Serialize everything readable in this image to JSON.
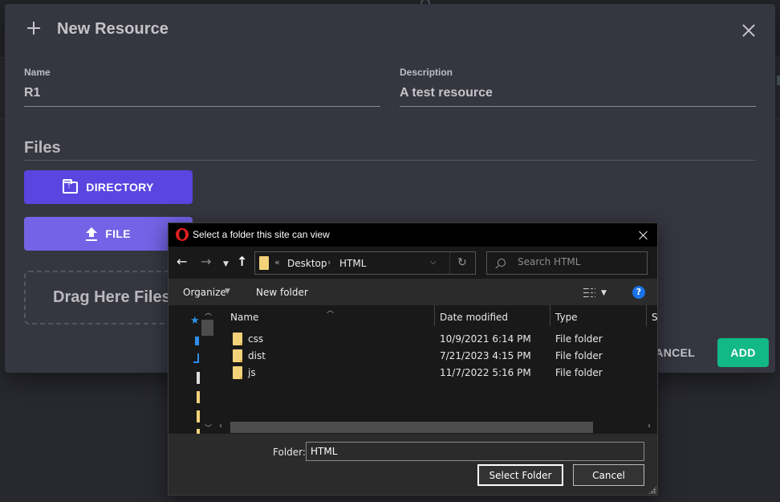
{
  "modal": {
    "title": "New Resource",
    "name_label": "Name",
    "name_value": "R1",
    "description_label": "Description",
    "description_value": "A test resource",
    "files_heading": "Files",
    "directory_button": "DIRECTORY",
    "file_button": "FILE",
    "dropzone_text": "Drag Here Files",
    "cancel_button": "CANCEL",
    "add_button": "ADD",
    "colors": {
      "directory_button": "#5a45e0",
      "file_button": "#7463e6",
      "add_button": "#12b886",
      "background": "#363641"
    }
  },
  "dialog": {
    "title": "Select a folder this site can view",
    "icons": {
      "app": "opera-logo-icon",
      "back": "←",
      "forward": "→",
      "recent": "⌄",
      "up": "↑",
      "refresh": "↻"
    },
    "address": {
      "overflow": "«",
      "crumbs": [
        "Desktop",
        "HTML"
      ],
      "separator": "›"
    },
    "search_placeholder": "Search HTML",
    "toolbar": {
      "organize": "Organize",
      "new_folder": "New folder",
      "help": "?"
    },
    "columns": [
      "Name",
      "Date modified",
      "Type",
      "S"
    ],
    "rows": [
      {
        "name": "css",
        "date": "10/9/2021 6:14 PM",
        "type": "File folder"
      },
      {
        "name": "dist",
        "date": "7/21/2023 4:15 PM",
        "type": "File folder"
      },
      {
        "name": "js",
        "date": "11/7/2022 5:16 PM",
        "type": "File folder"
      }
    ],
    "folder_label": "Folder:",
    "folder_value": "HTML",
    "select_button": "Select Folder",
    "cancel_button": "Cancel"
  }
}
